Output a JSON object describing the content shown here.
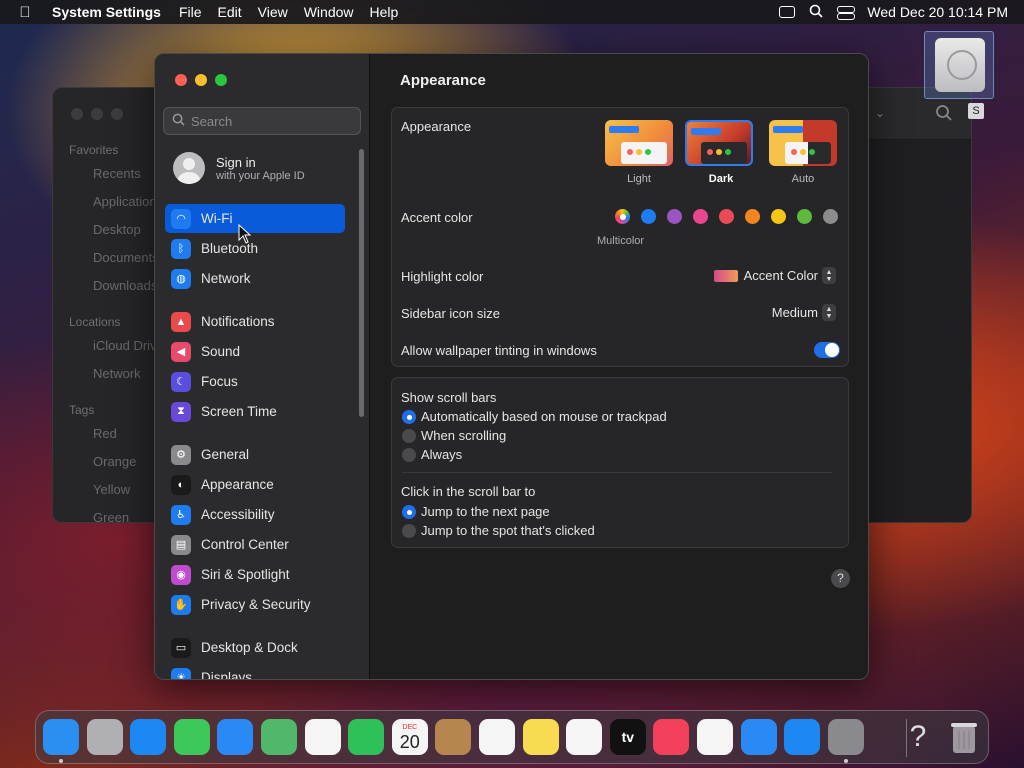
{
  "menubar": {
    "app_name": "System Settings",
    "menus": [
      "File",
      "Edit",
      "View",
      "Window",
      "Help"
    ],
    "clock": "Wed Dec 20  10:14 PM"
  },
  "finder": {
    "favorites_header": "Favorites",
    "favorites": [
      "Recents",
      "Applications",
      "Desktop",
      "Documents",
      "Downloads"
    ],
    "locations_header": "Locations",
    "locations": [
      "iCloud Drive",
      "Network"
    ],
    "tags_header": "Tags",
    "tags": [
      "Red",
      "Orange",
      "Yellow",
      "Green"
    ]
  },
  "desktop": {
    "drive_label_char": "S"
  },
  "sidebar": {
    "search_placeholder": "Search",
    "signin_title": "Sign in",
    "signin_subtitle": "with your Apple ID",
    "items": [
      {
        "label": "Wi-Fi",
        "color": "#1f7cf0",
        "icon": "wifi-icon",
        "glyph": "◠",
        "selected": true
      },
      {
        "label": "Bluetooth",
        "color": "#1f7cf0",
        "icon": "bluetooth-icon",
        "glyph": "ᛒ"
      },
      {
        "label": "Network",
        "color": "#1f7cf0",
        "icon": "globe-icon",
        "glyph": "◍"
      },
      {
        "label": "Notifications",
        "color": "#ea4a4a",
        "icon": "bell-icon",
        "glyph": "▲"
      },
      {
        "label": "Sound",
        "color": "#ea4a6a",
        "icon": "speaker-icon",
        "glyph": "◀"
      },
      {
        "label": "Focus",
        "color": "#5a4ee0",
        "icon": "moon-icon",
        "glyph": "☾"
      },
      {
        "label": "Screen Time",
        "color": "#6a48d8",
        "icon": "hourglass-icon",
        "glyph": "⧗"
      },
      {
        "label": "General",
        "color": "#8a8a8e",
        "icon": "gear-icon",
        "glyph": "⚙"
      },
      {
        "label": "Appearance",
        "color": "#1a1a1a",
        "icon": "appearance-icon",
        "glyph": "◐"
      },
      {
        "label": "Accessibility",
        "color": "#1f7cf0",
        "icon": "accessibility-icon",
        "glyph": "♿"
      },
      {
        "label": "Control Center",
        "color": "#8a8a8e",
        "icon": "control-center-icon",
        "glyph": "▤"
      },
      {
        "label": "Siri & Spotlight",
        "color": "#c04ad0",
        "icon": "siri-icon",
        "glyph": "◉"
      },
      {
        "label": "Privacy & Security",
        "color": "#1f7cf0",
        "icon": "hand-icon",
        "glyph": "✋"
      },
      {
        "label": "Desktop & Dock",
        "color": "#1a1a1a",
        "icon": "dock-icon",
        "glyph": "▭"
      },
      {
        "label": "Displays",
        "color": "#1f7cf0",
        "icon": "display-icon",
        "glyph": "☀"
      }
    ]
  },
  "content": {
    "title": "Appearance",
    "appearance_label": "Appearance",
    "appearance_options": [
      "Light",
      "Dark",
      "Auto"
    ],
    "appearance_selected": "Dark",
    "accent_label": "Accent color",
    "accent_colors": [
      "#ff4fa0",
      "#1f7cf0",
      "#9b55c2",
      "#e8478e",
      "#ea4a55",
      "#f2861e",
      "#f5c518",
      "#5fb93c",
      "#8c8c8c"
    ],
    "accent_selected_caption": "Multicolor",
    "highlight_label": "Highlight color",
    "highlight_value": "Accent Color",
    "icon_size_label": "Sidebar icon size",
    "icon_size_value": "Medium",
    "tinting_label": "Allow wallpaper tinting in windows",
    "tinting_on": true,
    "scrollbars_label": "Show scroll bars",
    "scrollbars_options": [
      "Automatically based on mouse or trackpad",
      "When scrolling",
      "Always"
    ],
    "click_label": "Click in the scroll bar to",
    "click_options": [
      "Jump to the next page",
      "Jump to the spot that's clicked"
    ],
    "help": "?"
  },
  "dock": {
    "apps": [
      {
        "name": "finder-icon",
        "color": "#2a8ff0"
      },
      {
        "name": "launchpad-icon",
        "color": "#b0b0b4"
      },
      {
        "name": "safari-icon",
        "color": "#1e88f2"
      },
      {
        "name": "messages-icon",
        "color": "#3cc85a"
      },
      {
        "name": "mail-icon",
        "color": "#2a8af5"
      },
      {
        "name": "maps-icon",
        "color": "#4fb86a"
      },
      {
        "name": "photos-icon",
        "color": "#f5f5f5"
      },
      {
        "name": "facetime-icon",
        "color": "#2fc05a"
      },
      {
        "name": "calendar-icon",
        "color": "#f5f5f5"
      },
      {
        "name": "contacts-icon",
        "color": "#b5874e"
      },
      {
        "name": "reminders-icon",
        "color": "#f5f5f5"
      },
      {
        "name": "notes-icon",
        "color": "#f7dc52"
      },
      {
        "name": "freeform-icon",
        "color": "#f5f5f5"
      },
      {
        "name": "tv-icon",
        "color": "#111111"
      },
      {
        "name": "music-icon",
        "color": "#f2405a"
      },
      {
        "name": "news-icon",
        "color": "#f5f5f5"
      },
      {
        "name": "keynote-icon",
        "color": "#2a8af5"
      },
      {
        "name": "app-store-icon",
        "color": "#1e88f2"
      },
      {
        "name": "system-settings-icon",
        "color": "#8a8a8e"
      }
    ],
    "calendar_month": "DEC",
    "calendar_day": "20",
    "tv_label": "tv",
    "help_glyph": "?"
  }
}
